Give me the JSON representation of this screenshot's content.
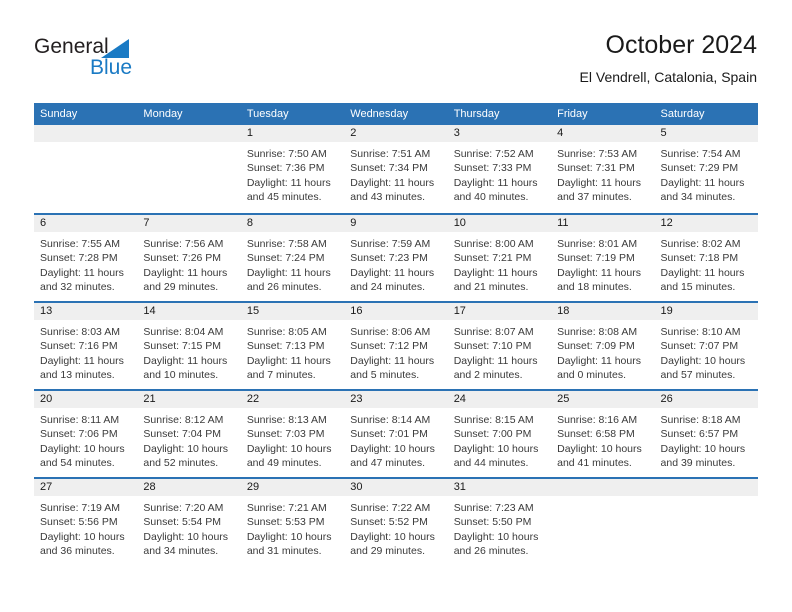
{
  "brand": {
    "name_part1": "General",
    "name_part2": "Blue",
    "logo_icon": "triangle-logo-icon",
    "accent_color": "#1a7ac4"
  },
  "header": {
    "title": "October 2024",
    "subtitle": "El Vendrell, Catalonia, Spain"
  },
  "theme": {
    "header_blue": "#2b72b4",
    "band_gray": "#efefef",
    "text_dark": "#1a1a1a"
  },
  "calendar": {
    "weekdays": [
      "Sunday",
      "Monday",
      "Tuesday",
      "Wednesday",
      "Thursday",
      "Friday",
      "Saturday"
    ],
    "weeks": [
      [
        {
          "day": "",
          "sunrise": "",
          "sunset": "",
          "daylight_line1": "",
          "daylight_line2": ""
        },
        {
          "day": "",
          "sunrise": "",
          "sunset": "",
          "daylight_line1": "",
          "daylight_line2": ""
        },
        {
          "day": "1",
          "sunrise": "Sunrise: 7:50 AM",
          "sunset": "Sunset: 7:36 PM",
          "daylight_line1": "Daylight: 11 hours",
          "daylight_line2": "and 45 minutes."
        },
        {
          "day": "2",
          "sunrise": "Sunrise: 7:51 AM",
          "sunset": "Sunset: 7:34 PM",
          "daylight_line1": "Daylight: 11 hours",
          "daylight_line2": "and 43 minutes."
        },
        {
          "day": "3",
          "sunrise": "Sunrise: 7:52 AM",
          "sunset": "Sunset: 7:33 PM",
          "daylight_line1": "Daylight: 11 hours",
          "daylight_line2": "and 40 minutes."
        },
        {
          "day": "4",
          "sunrise": "Sunrise: 7:53 AM",
          "sunset": "Sunset: 7:31 PM",
          "daylight_line1": "Daylight: 11 hours",
          "daylight_line2": "and 37 minutes."
        },
        {
          "day": "5",
          "sunrise": "Sunrise: 7:54 AM",
          "sunset": "Sunset: 7:29 PM",
          "daylight_line1": "Daylight: 11 hours",
          "daylight_line2": "and 34 minutes."
        }
      ],
      [
        {
          "day": "6",
          "sunrise": "Sunrise: 7:55 AM",
          "sunset": "Sunset: 7:28 PM",
          "daylight_line1": "Daylight: 11 hours",
          "daylight_line2": "and 32 minutes."
        },
        {
          "day": "7",
          "sunrise": "Sunrise: 7:56 AM",
          "sunset": "Sunset: 7:26 PM",
          "daylight_line1": "Daylight: 11 hours",
          "daylight_line2": "and 29 minutes."
        },
        {
          "day": "8",
          "sunrise": "Sunrise: 7:58 AM",
          "sunset": "Sunset: 7:24 PM",
          "daylight_line1": "Daylight: 11 hours",
          "daylight_line2": "and 26 minutes."
        },
        {
          "day": "9",
          "sunrise": "Sunrise: 7:59 AM",
          "sunset": "Sunset: 7:23 PM",
          "daylight_line1": "Daylight: 11 hours",
          "daylight_line2": "and 24 minutes."
        },
        {
          "day": "10",
          "sunrise": "Sunrise: 8:00 AM",
          "sunset": "Sunset: 7:21 PM",
          "daylight_line1": "Daylight: 11 hours",
          "daylight_line2": "and 21 minutes."
        },
        {
          "day": "11",
          "sunrise": "Sunrise: 8:01 AM",
          "sunset": "Sunset: 7:19 PM",
          "daylight_line1": "Daylight: 11 hours",
          "daylight_line2": "and 18 minutes."
        },
        {
          "day": "12",
          "sunrise": "Sunrise: 8:02 AM",
          "sunset": "Sunset: 7:18 PM",
          "daylight_line1": "Daylight: 11 hours",
          "daylight_line2": "and 15 minutes."
        }
      ],
      [
        {
          "day": "13",
          "sunrise": "Sunrise: 8:03 AM",
          "sunset": "Sunset: 7:16 PM",
          "daylight_line1": "Daylight: 11 hours",
          "daylight_line2": "and 13 minutes."
        },
        {
          "day": "14",
          "sunrise": "Sunrise: 8:04 AM",
          "sunset": "Sunset: 7:15 PM",
          "daylight_line1": "Daylight: 11 hours",
          "daylight_line2": "and 10 minutes."
        },
        {
          "day": "15",
          "sunrise": "Sunrise: 8:05 AM",
          "sunset": "Sunset: 7:13 PM",
          "daylight_line1": "Daylight: 11 hours",
          "daylight_line2": "and 7 minutes."
        },
        {
          "day": "16",
          "sunrise": "Sunrise: 8:06 AM",
          "sunset": "Sunset: 7:12 PM",
          "daylight_line1": "Daylight: 11 hours",
          "daylight_line2": "and 5 minutes."
        },
        {
          "day": "17",
          "sunrise": "Sunrise: 8:07 AM",
          "sunset": "Sunset: 7:10 PM",
          "daylight_line1": "Daylight: 11 hours",
          "daylight_line2": "and 2 minutes."
        },
        {
          "day": "18",
          "sunrise": "Sunrise: 8:08 AM",
          "sunset": "Sunset: 7:09 PM",
          "daylight_line1": "Daylight: 11 hours",
          "daylight_line2": "and 0 minutes."
        },
        {
          "day": "19",
          "sunrise": "Sunrise: 8:10 AM",
          "sunset": "Sunset: 7:07 PM",
          "daylight_line1": "Daylight: 10 hours",
          "daylight_line2": "and 57 minutes."
        }
      ],
      [
        {
          "day": "20",
          "sunrise": "Sunrise: 8:11 AM",
          "sunset": "Sunset: 7:06 PM",
          "daylight_line1": "Daylight: 10 hours",
          "daylight_line2": "and 54 minutes."
        },
        {
          "day": "21",
          "sunrise": "Sunrise: 8:12 AM",
          "sunset": "Sunset: 7:04 PM",
          "daylight_line1": "Daylight: 10 hours",
          "daylight_line2": "and 52 minutes."
        },
        {
          "day": "22",
          "sunrise": "Sunrise: 8:13 AM",
          "sunset": "Sunset: 7:03 PM",
          "daylight_line1": "Daylight: 10 hours",
          "daylight_line2": "and 49 minutes."
        },
        {
          "day": "23",
          "sunrise": "Sunrise: 8:14 AM",
          "sunset": "Sunset: 7:01 PM",
          "daylight_line1": "Daylight: 10 hours",
          "daylight_line2": "and 47 minutes."
        },
        {
          "day": "24",
          "sunrise": "Sunrise: 8:15 AM",
          "sunset": "Sunset: 7:00 PM",
          "daylight_line1": "Daylight: 10 hours",
          "daylight_line2": "and 44 minutes."
        },
        {
          "day": "25",
          "sunrise": "Sunrise: 8:16 AM",
          "sunset": "Sunset: 6:58 PM",
          "daylight_line1": "Daylight: 10 hours",
          "daylight_line2": "and 41 minutes."
        },
        {
          "day": "26",
          "sunrise": "Sunrise: 8:18 AM",
          "sunset": "Sunset: 6:57 PM",
          "daylight_line1": "Daylight: 10 hours",
          "daylight_line2": "and 39 minutes."
        }
      ],
      [
        {
          "day": "27",
          "sunrise": "Sunrise: 7:19 AM",
          "sunset": "Sunset: 5:56 PM",
          "daylight_line1": "Daylight: 10 hours",
          "daylight_line2": "and 36 minutes."
        },
        {
          "day": "28",
          "sunrise": "Sunrise: 7:20 AM",
          "sunset": "Sunset: 5:54 PM",
          "daylight_line1": "Daylight: 10 hours",
          "daylight_line2": "and 34 minutes."
        },
        {
          "day": "29",
          "sunrise": "Sunrise: 7:21 AM",
          "sunset": "Sunset: 5:53 PM",
          "daylight_line1": "Daylight: 10 hours",
          "daylight_line2": "and 31 minutes."
        },
        {
          "day": "30",
          "sunrise": "Sunrise: 7:22 AM",
          "sunset": "Sunset: 5:52 PM",
          "daylight_line1": "Daylight: 10 hours",
          "daylight_line2": "and 29 minutes."
        },
        {
          "day": "31",
          "sunrise": "Sunrise: 7:23 AM",
          "sunset": "Sunset: 5:50 PM",
          "daylight_line1": "Daylight: 10 hours",
          "daylight_line2": "and 26 minutes."
        },
        {
          "day": "",
          "sunrise": "",
          "sunset": "",
          "daylight_line1": "",
          "daylight_line2": ""
        },
        {
          "day": "",
          "sunrise": "",
          "sunset": "",
          "daylight_line1": "",
          "daylight_line2": ""
        }
      ]
    ]
  }
}
